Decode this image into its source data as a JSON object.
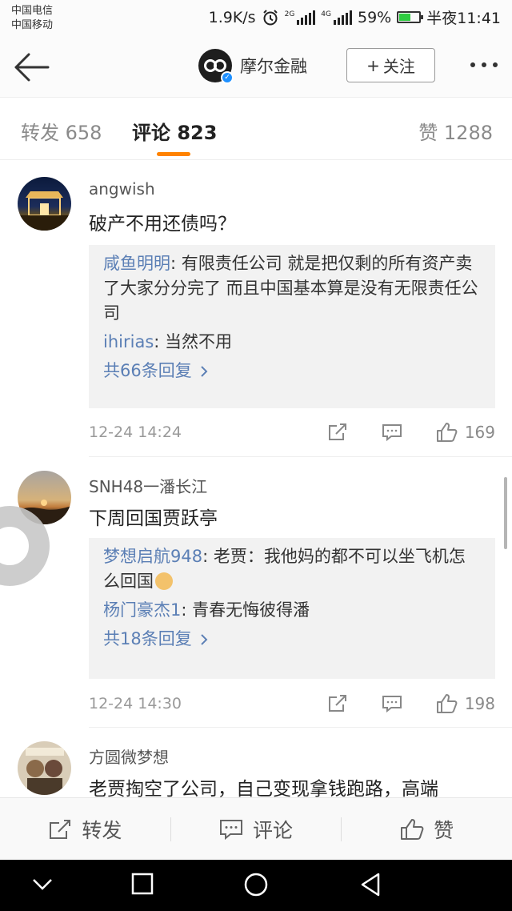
{
  "status_bar": {
    "carrier1": "中国电信",
    "carrier2": "中国移动",
    "speed": "1.9K/s",
    "net1": "2G",
    "net2": "4G",
    "battery": "59%",
    "battery_level": 0.59,
    "time": "半夜11:41"
  },
  "nav": {
    "title": "摩尔金融",
    "follow_label": "关注",
    "follow_plus": "+"
  },
  "tabs": [
    {
      "label": "转发 658"
    },
    {
      "label": "评论 823"
    },
    {
      "label": "赞 1288"
    }
  ],
  "comments": [
    {
      "user": "angwish",
      "text": "破产不用还债吗？",
      "replies": [
        {
          "name": "咸鱼明明",
          "text": ": 有限责任公司  就是把仅剩的所有资产卖了大家分分完了  而且中国基本算是没有无限责任公司"
        },
        {
          "name": "ihirias",
          "text": ": 当然不用"
        }
      ],
      "more_replies": "共66条回复",
      "time": "12-24 14:24",
      "likes": "169"
    },
    {
      "user": "SNH48一潘长江",
      "text": "下周回国贾跃亭",
      "replies": [
        {
          "name": "梦想启航948",
          "text": ": 老贾：我他妈的都不可以坐飞机怎么回国"
        },
        {
          "name": "杨门豪杰1",
          "text": ": 青春无悔彼得潘"
        }
      ],
      "more_replies": "共18条回复",
      "time": "12-24 14:30",
      "likes": "198"
    },
    {
      "user": "方圆微梦想",
      "text": "老贾掏空了公司，自己变现拿钱跑路，高端"
    }
  ],
  "bottom_bar": {
    "repost": "转发",
    "comment": "评论",
    "like": "赞"
  },
  "colors": {
    "accent": "#ff8200",
    "link": "#5b7fb5"
  }
}
